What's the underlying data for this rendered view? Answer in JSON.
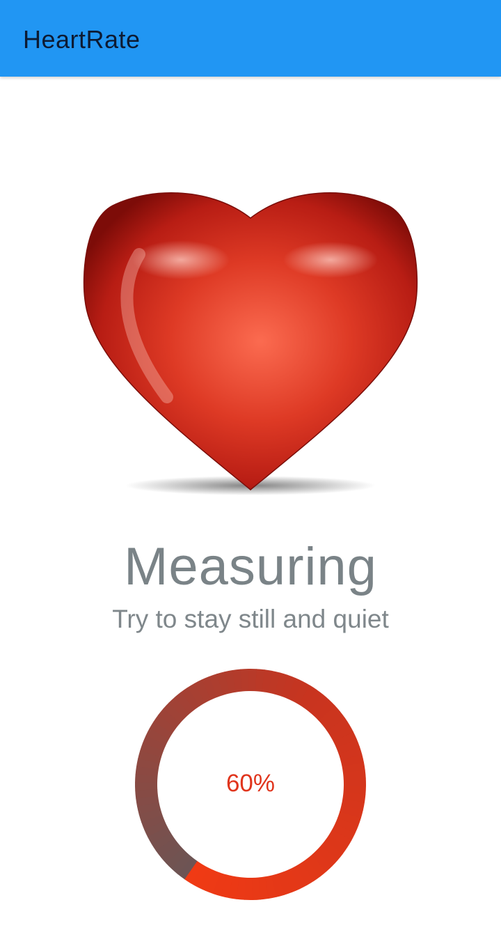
{
  "app_bar": {
    "title": "HeartRate",
    "color": "#2196f3"
  },
  "hero": {
    "icon": "heart-icon"
  },
  "status": {
    "title": "Measuring",
    "subtitle": "Try to stay still and quiet"
  },
  "progress": {
    "label": "60%",
    "value": 0.6,
    "colors": {
      "start": "#f03a14",
      "mid": "#c8341f",
      "end": "#6b5555"
    }
  }
}
